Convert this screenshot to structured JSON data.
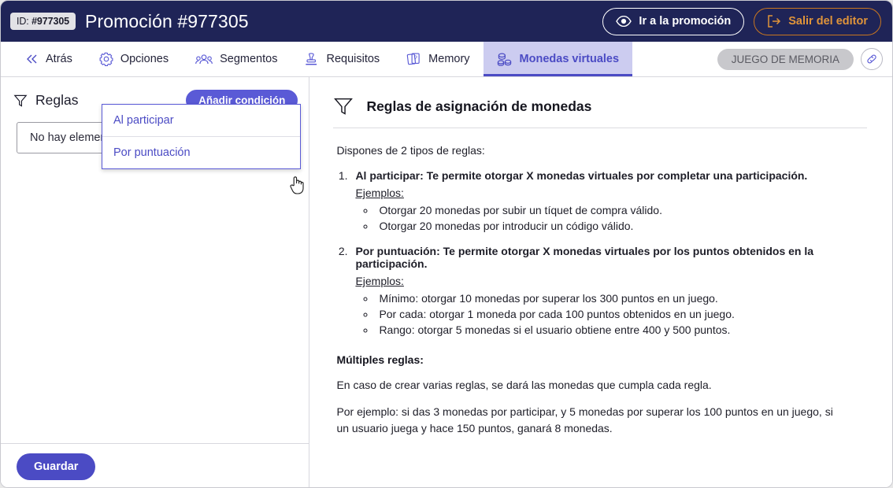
{
  "topbar": {
    "id_label": "ID:",
    "id_value": "#977305",
    "title": "Promoción #977305",
    "view_button": "Ir a la promoción",
    "exit_button": "Salir del editor",
    "view_icon": "eye-icon",
    "exit_icon": "logout-arrow-icon"
  },
  "tabs": [
    {
      "label": "Atrás",
      "icon": "double-chevron-left-icon",
      "active": false
    },
    {
      "label": "Opciones",
      "icon": "gear-icon",
      "active": false
    },
    {
      "label": "Segmentos",
      "icon": "users-group-icon",
      "active": false
    },
    {
      "label": "Requisitos",
      "icon": "stamp-icon",
      "active": false
    },
    {
      "label": "Memory",
      "icon": "memory-cards-icon",
      "active": false
    },
    {
      "label": "Monedas virtuales",
      "icon": "coins-stack-icon",
      "active": true
    }
  ],
  "tabbar_right": {
    "game_badge": "JUEGO DE MEMORIA",
    "link_icon": "chain-link-icon"
  },
  "left_panel": {
    "header_title": "Reglas",
    "header_icon": "funnel-filter-icon",
    "add_condition_button": "Añadir condición",
    "empty_text": "No hay elementos",
    "save_button": "Guardar",
    "dropdown": {
      "items": [
        "Al participar",
        "Por puntuación"
      ]
    },
    "cursor": "pointing-hand-cursor"
  },
  "right_panel": {
    "title": "Reglas de asignación de monedas",
    "title_icon": "funnel-filter-icon",
    "intro": "Dispones de 2 tipos de reglas:",
    "rules": [
      {
        "lead": "Al participar:",
        "rest": " Te permite otorgar X monedas virtuales por completar una participación.",
        "examples_label": "Ejemplos:",
        "examples": [
          "Otorgar 20 monedas por subir un tíquet de compra válido.",
          "Otorgar 20 monedas por introducir un código válido."
        ]
      },
      {
        "lead": "Por puntuación:",
        "rest": " Te permite otorgar X monedas virtuales por los puntos obtenidos en la participación.",
        "examples_label": "Ejemplos:",
        "examples": [
          "Mínimo: otorgar 10 monedas por superar los 300 puntos en un juego.",
          "Por cada: otorgar 1 moneda por cada 100 puntos obtenidos en un juego.",
          "Rango: otorgar 5 monedas si el usuario obtiene entre 400 y 500 puntos."
        ]
      }
    ],
    "multiple_title": "Múltiples reglas:",
    "multiple_p1": "En caso de crear varias reglas, se dará las monedas que cumpla cada regla.",
    "multiple_p2": "Por ejemplo: si das 3 monedas por participar, y 5 monedas por superar los 100 puntos en un juego, si un usuario juega y hace 150 puntos, ganará 8 monedas."
  },
  "colors": {
    "header_bg": "#1f2457",
    "accent": "#5a5ad6",
    "accent_dark": "#4b4bc4",
    "exit_orange": "#e0943a",
    "active_tab_bg": "#ccccf0",
    "badge_gray": "#c8c8cc"
  }
}
